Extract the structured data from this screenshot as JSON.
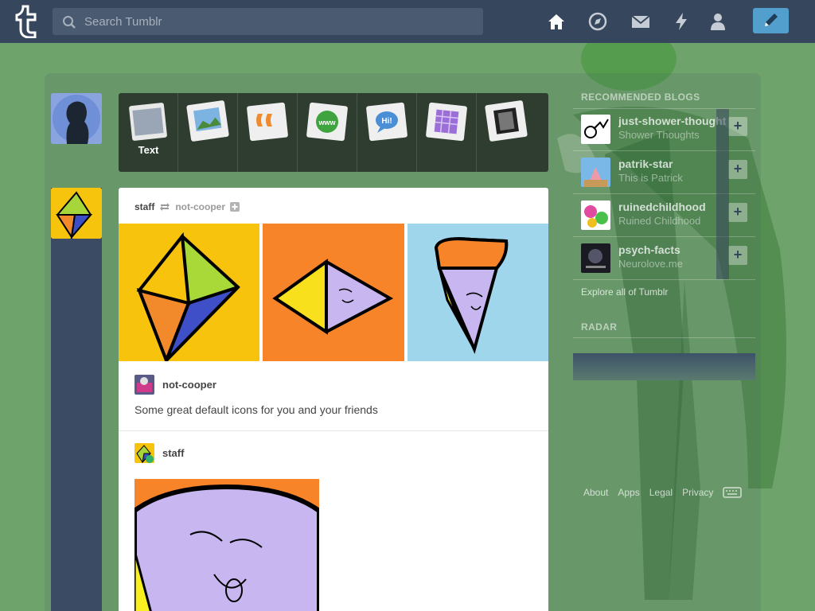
{
  "header": {
    "search_placeholder": "Search Tumblr",
    "nav": [
      "home-icon",
      "explore-icon",
      "inbox-icon",
      "activity-icon",
      "account-icon"
    ],
    "compose_icon": "pencil-icon"
  },
  "post_types": [
    {
      "type": "text",
      "label": "Text"
    },
    {
      "type": "photo",
      "label": ""
    },
    {
      "type": "quote",
      "label": ""
    },
    {
      "type": "link",
      "label": ""
    },
    {
      "type": "chat",
      "label": ""
    },
    {
      "type": "audio",
      "label": ""
    },
    {
      "type": "video",
      "label": ""
    }
  ],
  "post": {
    "author": "staff",
    "reblogged_from": "not-cooper",
    "reblog_user": "not-cooper",
    "caption": "Some great default icons for you and your friends",
    "reblog_user2": "staff"
  },
  "sidebar": {
    "recommended_heading": "RECOMMENDED BLOGS",
    "blogs": [
      {
        "name": "just-shower-thoughts",
        "title": "Shower Thoughts"
      },
      {
        "name": "patrik-star",
        "title": "This is Patrick"
      },
      {
        "name": "ruinedchildhood",
        "title": "Ruined Childhood"
      },
      {
        "name": "psych-facts",
        "title": "Neurolove.me"
      }
    ],
    "explore": "Explore all of Tumblr",
    "radar_heading": "RADAR"
  },
  "footer": {
    "links": [
      "About",
      "Apps",
      "Legal",
      "Privacy"
    ]
  },
  "colors": {
    "background": "#6fa36c",
    "header": "#36465d",
    "compose": "#529ecc"
  }
}
